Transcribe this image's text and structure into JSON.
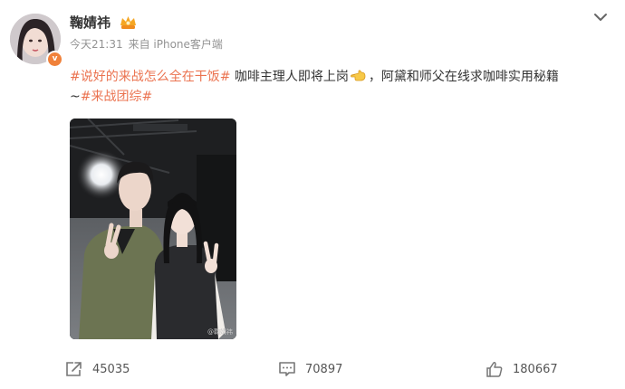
{
  "post": {
    "author": "鞠婧祎",
    "badge_letter": "v",
    "time": "今天21:31",
    "source": "来自 iPhone客户端",
    "text": {
      "topic1": "#说好的来战怎么全在干饭#",
      "body1": " 咖啡主理人即将上岗",
      "body2": "，阿黛和师父在线求咖啡实用秘籍",
      "prefix2": "~",
      "topic2": "#来战团综#"
    },
    "image_watermark": "@鞠婧祎",
    "icons": [
      "vip-crown-icon",
      "chevron-down-icon",
      "pointing-hand-icon",
      "repost-icon",
      "comment-icon",
      "like-icon"
    ]
  },
  "actions": {
    "repost_count": "45035",
    "comment_count": "70897",
    "like_count": "180667"
  },
  "colors": {
    "topic": "#eb7350",
    "meta": "#939393",
    "badge": "#f0813a"
  }
}
